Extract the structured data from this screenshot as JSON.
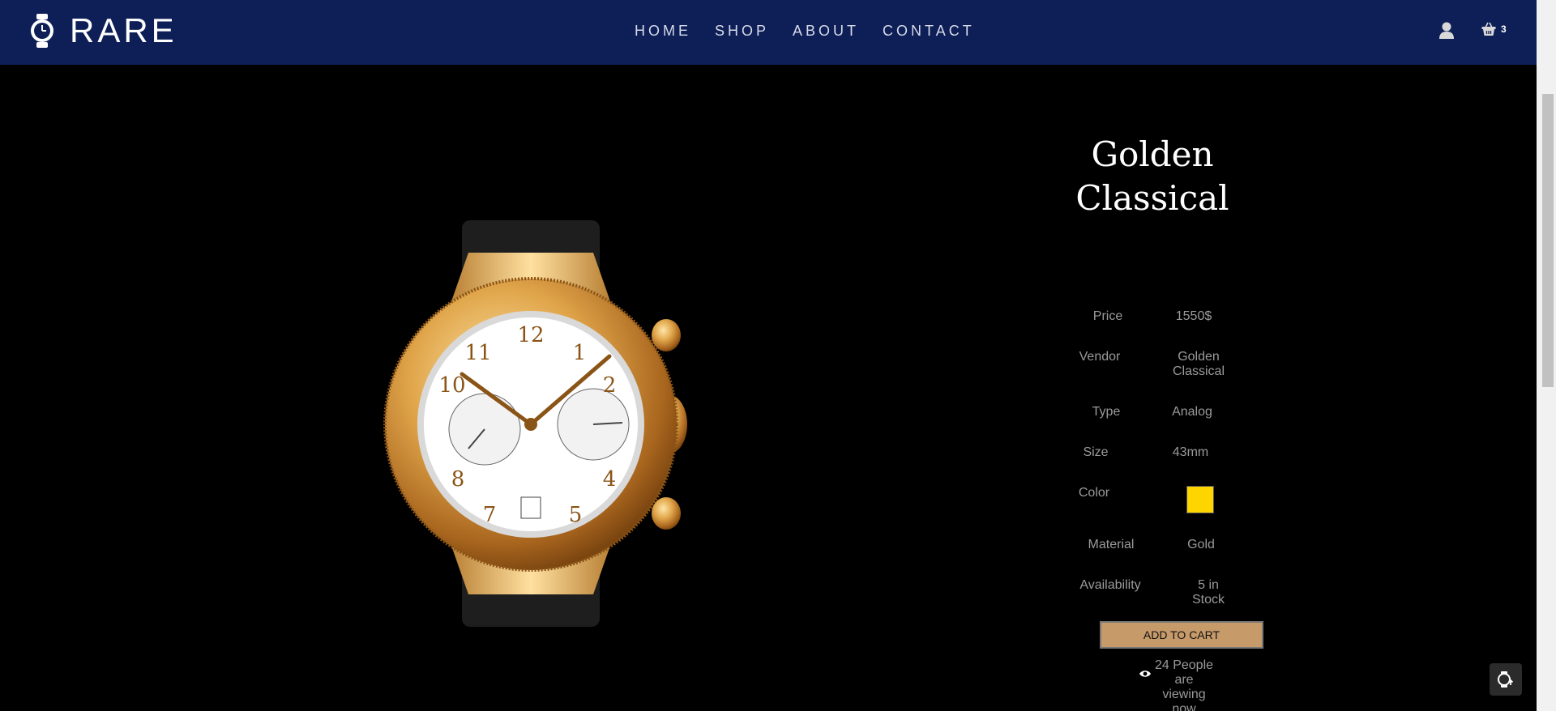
{
  "brand": {
    "name": "RARE",
    "icon": "watch-icon"
  },
  "nav": {
    "items": [
      "HOME",
      "SHOP",
      "ABOUT",
      "CONTACT"
    ]
  },
  "header_actions": {
    "user_icon": "user-icon",
    "cart_icon": "basket-icon",
    "cart_count": "3"
  },
  "product": {
    "title_line1": "Golden",
    "title_line2": "Classical",
    "specs": {
      "price_label": "Price",
      "price": "1550$",
      "vendor_label": "Vendor",
      "vendor_line1": "Golden",
      "vendor_line2": "Classical",
      "type_label": "Type",
      "type": "Analog",
      "size_label": "Size",
      "size": "43mm",
      "color_label": "Color",
      "color_swatch": "#ffd500",
      "material_label": "Material",
      "material": "Gold",
      "availability_label": "Availability",
      "availability_line1": "5 in",
      "availability_line2": "Stock"
    },
    "add_to_cart": "ADD TO CART",
    "viewing": {
      "line1": "24 People",
      "line2": "are",
      "line3": "viewing",
      "line4": "now"
    }
  },
  "colors": {
    "header_bg": "#0e1e57",
    "page_bg": "#000000",
    "button_bg": "#c79a6a"
  }
}
